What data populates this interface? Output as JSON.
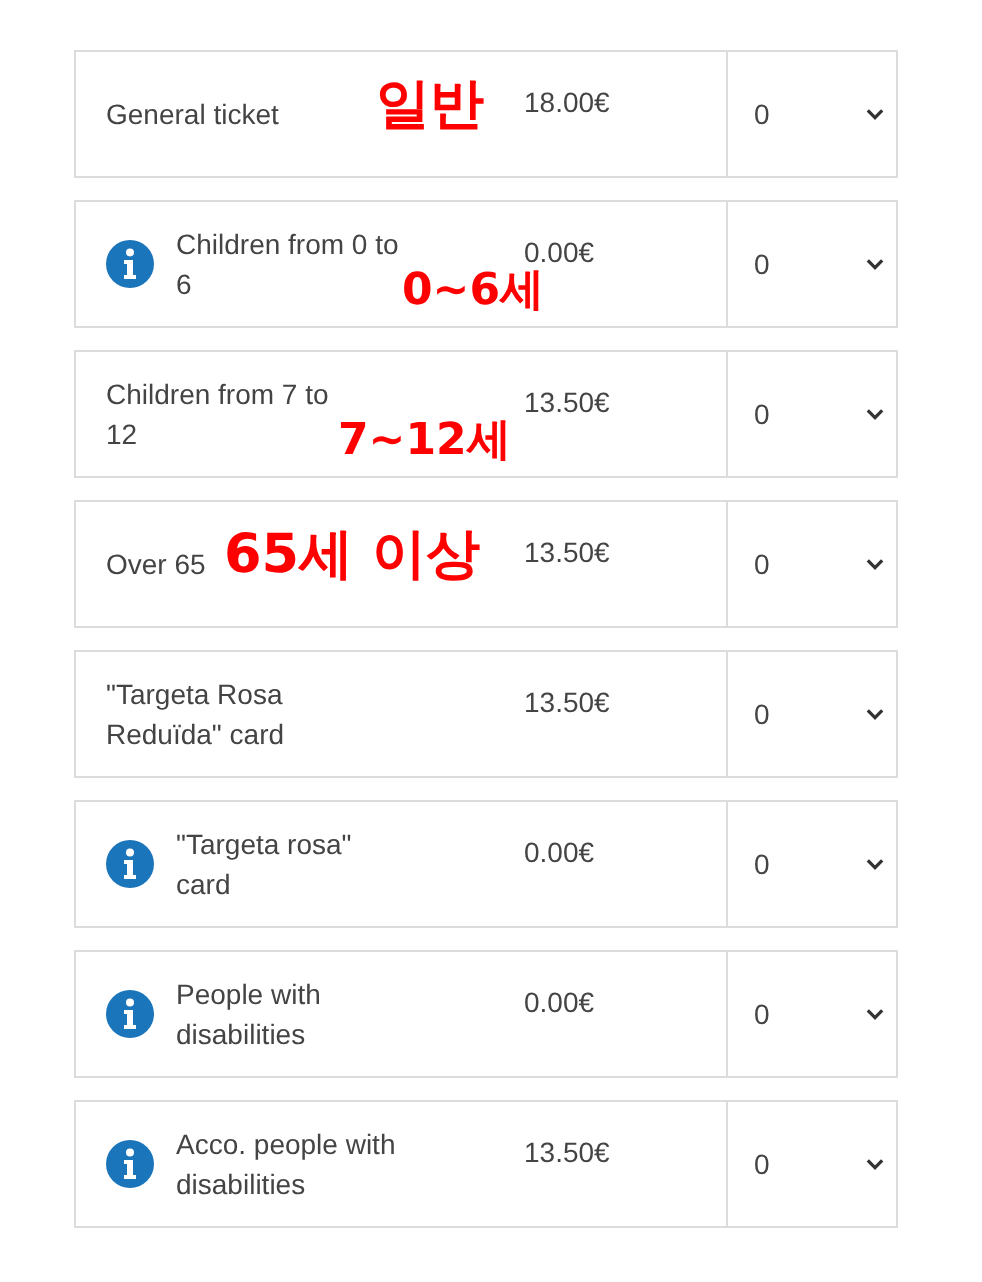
{
  "tickets": [
    {
      "label": "General ticket",
      "info": false,
      "annotation": "일반",
      "price": "18.00€",
      "quantity": "0"
    },
    {
      "label": "Children from 0 to 6",
      "info": true,
      "annotation": "0~6세",
      "price": "0.00€",
      "quantity": "0"
    },
    {
      "label": "Children from 7 to 12",
      "info": false,
      "annotation": "7~12세",
      "price": "13.50€",
      "quantity": "0"
    },
    {
      "label": "Over 65",
      "info": false,
      "annotation": "65세 이상",
      "price": "13.50€",
      "quantity": "0"
    },
    {
      "label": "\"Targeta Rosa Reduïda\" card",
      "info": false,
      "price": "13.50€",
      "quantity": "0"
    },
    {
      "label": "\"Targeta rosa\" card",
      "info": true,
      "price": "0.00€",
      "quantity": "0"
    },
    {
      "label": "People with disabilities",
      "info": true,
      "price": "0.00€",
      "quantity": "0"
    },
    {
      "label": "Acco. people with disabilities",
      "info": true,
      "price": "13.50€",
      "quantity": "0"
    }
  ]
}
